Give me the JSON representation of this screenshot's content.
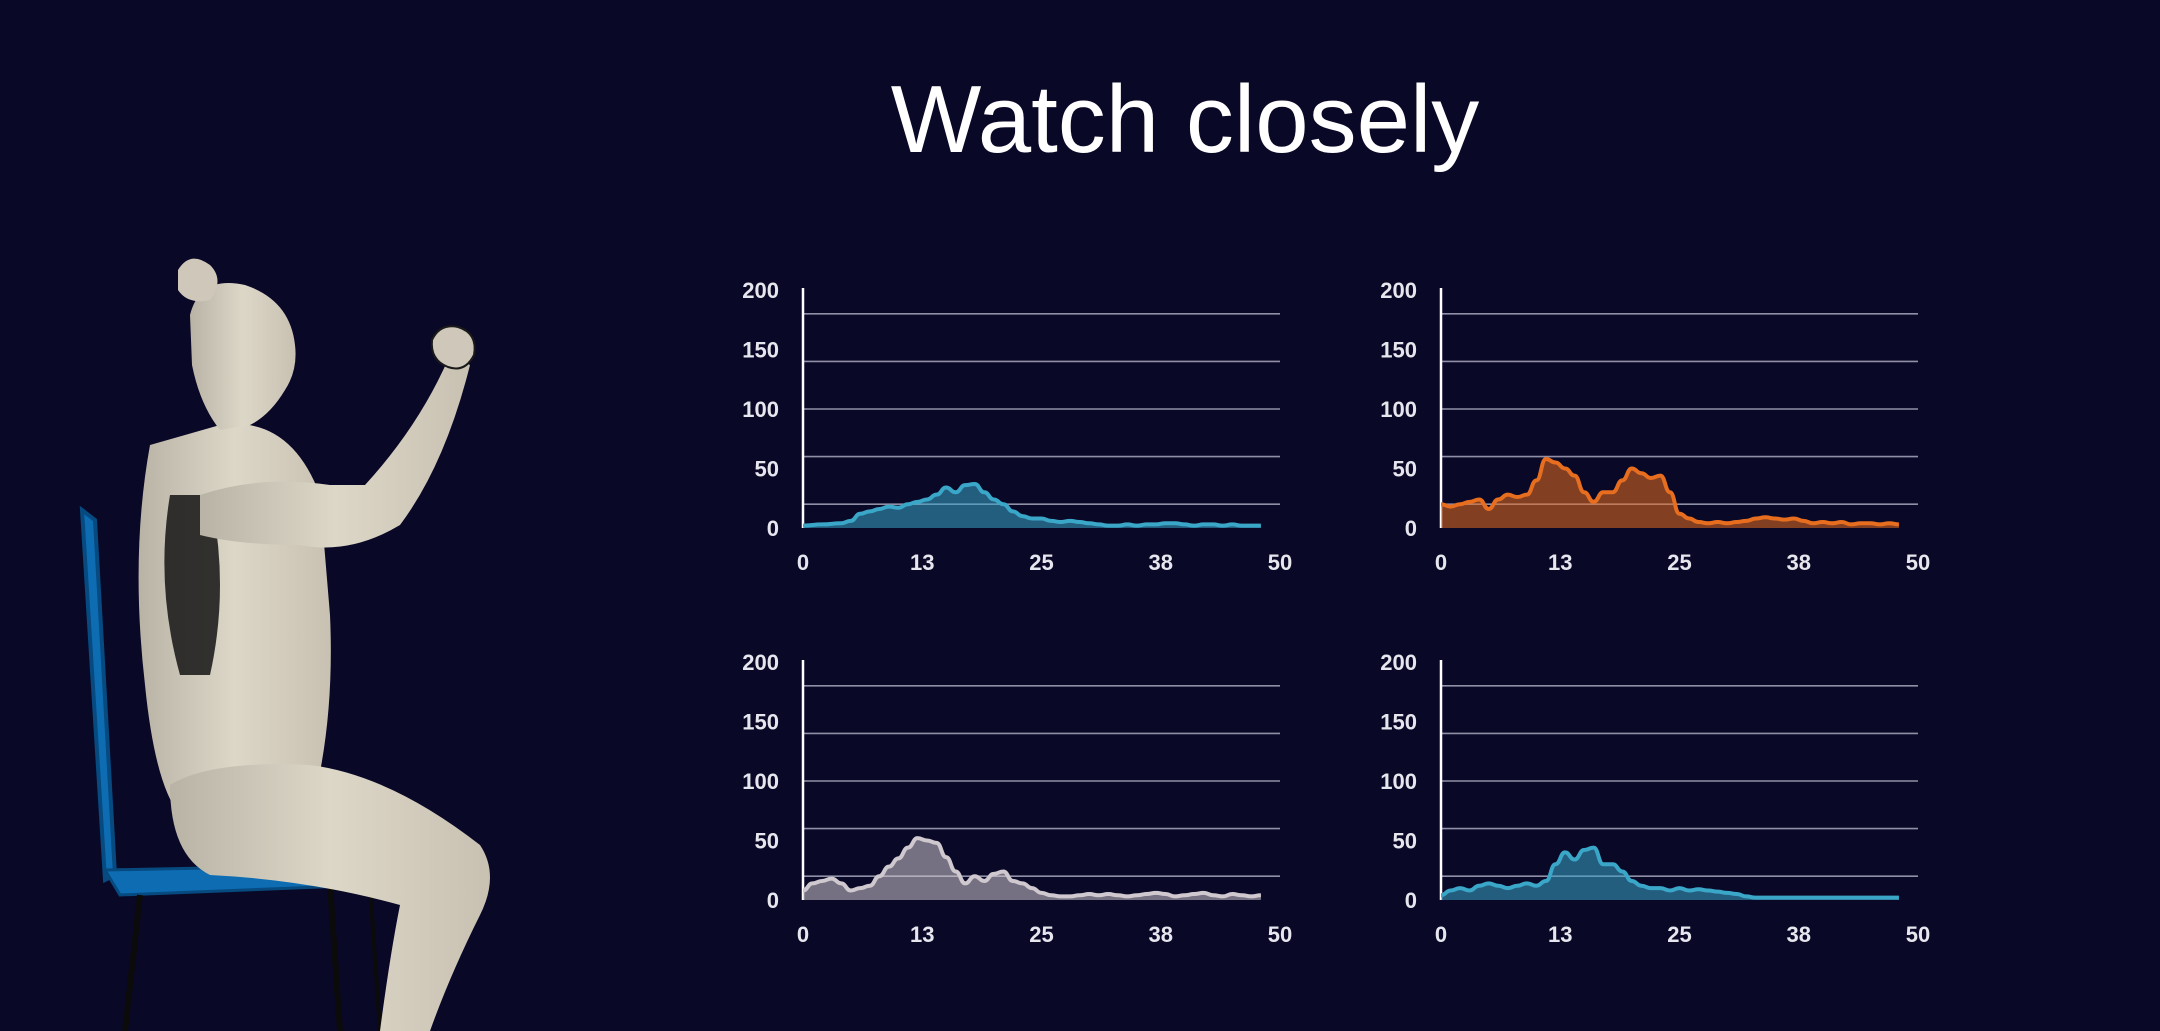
{
  "title": "Watch closely",
  "colors": {
    "background": "#0a0827",
    "grid": "#8f8fa6",
    "axis": "#ffffff",
    "chair": "#0d6cb2",
    "skin": "#d6cfc0"
  },
  "chart_data": [
    {
      "type": "area",
      "color": "#3aa6c8",
      "ylim": [
        0,
        200
      ],
      "xlim": [
        0,
        50
      ],
      "yticks": [
        "200",
        "150",
        "100",
        "50",
        "0"
      ],
      "xticks": [
        "0",
        "13",
        "25",
        "38",
        "50"
      ],
      "grid": true,
      "series": [
        {
          "x": [
            0,
            2,
            4,
            5,
            6,
            7,
            8,
            9,
            10,
            11,
            12,
            13,
            14,
            15,
            16,
            17,
            18,
            19,
            20,
            21,
            22,
            23,
            24,
            25,
            26,
            27,
            28,
            29,
            30,
            31,
            32,
            33,
            34,
            35,
            36,
            37,
            38,
            39,
            40,
            41,
            42,
            43,
            44,
            45,
            46,
            47,
            48
          ],
          "y": [
            2,
            3,
            4,
            6,
            12,
            14,
            16,
            18,
            17,
            20,
            22,
            24,
            28,
            34,
            30,
            36,
            37,
            30,
            24,
            20,
            14,
            10,
            8,
            8,
            6,
            5,
            6,
            5,
            4,
            3,
            2,
            2,
            3,
            2,
            3,
            3,
            4,
            4,
            3,
            2,
            3,
            3,
            2,
            3,
            2,
            2,
            2
          ]
        }
      ]
    },
    {
      "type": "area",
      "color": "#e86e1f",
      "ylim": [
        0,
        200
      ],
      "xlim": [
        0,
        50
      ],
      "yticks": [
        "200",
        "150",
        "100",
        "50",
        "0"
      ],
      "xticks": [
        "0",
        "13",
        "25",
        "38",
        "50"
      ],
      "grid": true,
      "series": [
        {
          "x": [
            0,
            1,
            2,
            3,
            4,
            5,
            6,
            7,
            8,
            9,
            10,
            11,
            12,
            13,
            14,
            15,
            16,
            17,
            18,
            19,
            20,
            21,
            22,
            23,
            24,
            25,
            26,
            27,
            28,
            29,
            30,
            31,
            32,
            33,
            34,
            35,
            36,
            37,
            38,
            39,
            40,
            41,
            42,
            43,
            44,
            45,
            46,
            47,
            48
          ],
          "y": [
            20,
            18,
            20,
            22,
            24,
            16,
            24,
            28,
            26,
            28,
            40,
            58,
            55,
            50,
            44,
            30,
            22,
            30,
            30,
            40,
            50,
            46,
            42,
            44,
            30,
            12,
            8,
            5,
            4,
            5,
            4,
            5,
            6,
            8,
            9,
            8,
            7,
            8,
            6,
            4,
            5,
            4,
            5,
            3,
            4,
            4,
            3,
            4,
            3
          ]
        }
      ]
    },
    {
      "type": "area",
      "color": "#cfc8ce",
      "ylim": [
        0,
        200
      ],
      "xlim": [
        0,
        50
      ],
      "yticks": [
        "200",
        "150",
        "100",
        "50",
        "0"
      ],
      "xticks": [
        "0",
        "13",
        "25",
        "38",
        "50"
      ],
      "grid": true,
      "series": [
        {
          "x": [
            0,
            1,
            2,
            3,
            4,
            5,
            6,
            7,
            8,
            9,
            10,
            11,
            12,
            13,
            14,
            15,
            16,
            17,
            18,
            19,
            20,
            21,
            22,
            23,
            24,
            25,
            26,
            27,
            28,
            29,
            30,
            31,
            32,
            33,
            34,
            35,
            36,
            37,
            38,
            39,
            40,
            41,
            42,
            43,
            44,
            45,
            46,
            47,
            48
          ],
          "y": [
            8,
            14,
            16,
            18,
            14,
            8,
            10,
            12,
            20,
            28,
            35,
            44,
            52,
            50,
            48,
            36,
            24,
            14,
            20,
            16,
            22,
            24,
            16,
            14,
            10,
            6,
            4,
            3,
            3,
            4,
            5,
            4,
            5,
            4,
            3,
            4,
            5,
            6,
            5,
            3,
            4,
            5,
            6,
            4,
            3,
            5,
            4,
            3,
            4
          ]
        }
      ]
    },
    {
      "type": "area",
      "color": "#3aa6c8",
      "ylim": [
        0,
        200
      ],
      "xlim": [
        0,
        50
      ],
      "yticks": [
        "200",
        "150",
        "100",
        "50",
        "0"
      ],
      "xticks": [
        "0",
        "13",
        "25",
        "38",
        "50"
      ],
      "grid": true,
      "series": [
        {
          "x": [
            0,
            1,
            2,
            3,
            4,
            5,
            6,
            7,
            8,
            9,
            10,
            11,
            12,
            13,
            14,
            15,
            16,
            17,
            18,
            19,
            20,
            21,
            22,
            23,
            24,
            25,
            26,
            27,
            28,
            29,
            30,
            31,
            32,
            33,
            34,
            35,
            36,
            37,
            38,
            39,
            40,
            41,
            42,
            43,
            44,
            45,
            46,
            47,
            48
          ],
          "y": [
            4,
            8,
            10,
            8,
            12,
            14,
            12,
            10,
            12,
            14,
            12,
            16,
            30,
            40,
            34,
            42,
            44,
            30,
            30,
            24,
            16,
            12,
            10,
            10,
            8,
            10,
            8,
            9,
            8,
            7,
            6,
            5,
            3,
            2,
            2,
            2,
            2,
            2,
            2,
            2,
            2,
            2,
            2,
            2,
            2,
            2,
            2,
            2,
            2
          ]
        }
      ]
    }
  ]
}
